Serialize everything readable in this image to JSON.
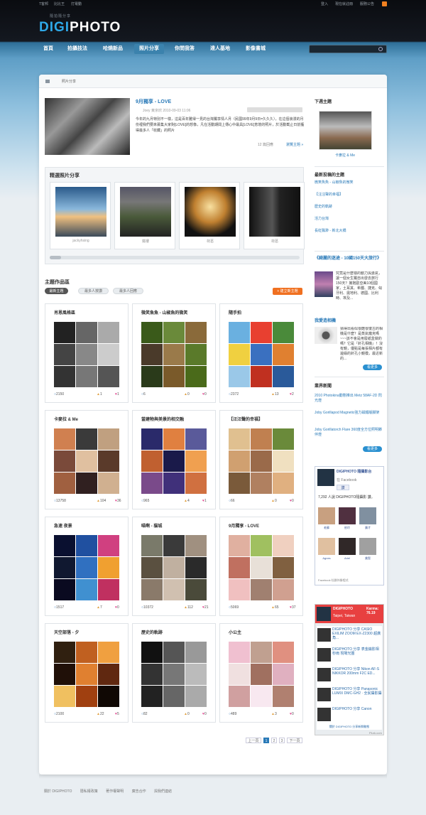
{
  "topbar": {
    "left": [
      "T客邦",
      "比比王",
      "打電動"
    ],
    "right": [
      "登入",
      "現在就註冊",
      "服務公告"
    ]
  },
  "logo": {
    "main": "DIGI",
    "main2": "PHOTO",
    "tagline": "隨拍隨分享"
  },
  "nav": {
    "items": [
      "首頁",
      "拍攝技法",
      "哈燒新品",
      "照片分享",
      "你問我答",
      "達人基地",
      "影像書城"
    ],
    "active": 3
  },
  "search": {
    "placeholder": ""
  },
  "breadcrumb": {
    "label": "照片分享"
  },
  "featured": {
    "title": "9月獨享 - LOVE",
    "meta": "Joey 東京欣 2010-09-03 11:06",
    "text": "今年的九月特別不一樣，這是百年難得一見的台灣獨享情人月（民國99年9月9日=久久久），在這個浪漫的月份裡我們要來募集大家對[LOVE]的想像，凡在活動期間上傳心中最具[LOVE]意境的照片，於活動截止日前獲得最多人「收藏」的照片",
    "comments": "12 篇回應",
    "more": "瀏覽主題 »"
  },
  "picks": {
    "title": "精選照片分享",
    "items": [
      {
        "name": "jackyhsing"
      },
      {
        "name": "鐵樓"
      },
      {
        "name": "荷葛"
      },
      {
        "name": "荷葛"
      }
    ]
  },
  "topics": {
    "title": "主題作品區",
    "tabs": [
      "最新主題",
      "最多人按讚",
      "最多人回應"
    ],
    "new_button": "+ 建立新主題",
    "cards": [
      {
        "title": "肖恩風格區",
        "views": "2150",
        "likes": "1",
        "hearts": "1"
      },
      {
        "title": "微笑魚魚 - 山椒魚的微笑",
        "views": "6",
        "likes": "0",
        "hearts": "0"
      },
      {
        "title": "隨手拍",
        "views": "2372",
        "likes": "13",
        "hearts": "2"
      },
      {
        "title": "卡麥拉 & Me",
        "views": "13758",
        "likes": "104",
        "hearts": "36"
      },
      {
        "title": "當建物與美景的相交融",
        "views": "965",
        "likes": "4",
        "hearts": "1"
      },
      {
        "title": "【汪汪聲的幸福】",
        "views": "66",
        "likes": "0",
        "hearts": "0"
      },
      {
        "title": "急速 夜景",
        "views": "1517",
        "likes": "7",
        "hearts": "0"
      },
      {
        "title": "喵啊 - 貓城",
        "views": "10372",
        "likes": "112",
        "hearts": "21"
      },
      {
        "title": "9月獨享 - LOVE",
        "views": "5069",
        "likes": "65",
        "hearts": "37"
      },
      {
        "title": "天空部落 - 夕",
        "views": "2100",
        "likes": "22",
        "hearts": "5"
      },
      {
        "title": "歷史的軌跡",
        "views": "82",
        "likes": "0",
        "hearts": "0"
      },
      {
        "title": "小公主",
        "views": "489",
        "likes": "3",
        "hearts": "0"
      }
    ]
  },
  "pagination": {
    "prev": "上一頁",
    "pages": [
      "1",
      "2",
      "3"
    ],
    "next": "下一頁",
    "current": "1"
  },
  "sidebar": {
    "next_title": "下週主題",
    "next_caption": "卡麥拉 & Me",
    "recent_title": "最新投稿的主題",
    "recent": [
      "微笑魚魚 - 山椒魚的微笑",
      "【汪汪聲的幸福】",
      "歷史的軌跡",
      "活力台灣",
      "長虹飄渺 - 新北大橋"
    ],
    "book_title": "《綺麗的迷途 - 10國150天大旅行》",
    "book_text": "究竟是什麼樣的動力與勇氣，讓一個女生獨自出發去旅行150天？擁抱歐亞美10個國家，土耳其、希臘、捷克、匈牙利、奧地利、德國、比利時、埃及...",
    "camera_title": "我愛造相機",
    "camera_text": "猜得出看似很酷很復古的相機是什麼？是蒸氣龐克嗎~~~該不會是用廢紙盒做的嗎？它是『針孔相機』！沒有鏡，優點是每張相片都有邊緣的針孔小鏡模，最近新的...",
    "more": "看更多",
    "news_title": "業界新聞",
    "news": [
      "2010 Photokina動態推出 Metz 58AF-2D 閃光燈",
      "Joby Gorillapod Magnetic強力磁鐵版腳架",
      "Joby Gorillatorch Flare 360度全方位照明夥伴燈"
    ],
    "fb_name": "DIGIPHOTO 隨攝影台",
    "fb_sub": "在 Facebook",
    "fb_like": "讚",
    "fb_count": "7,292 人說 DIGIPHOTO隨攝影 讚。",
    "fb_people": [
      "老蘇",
      "依玲",
      "廣才",
      "Agnes",
      "Ariel",
      "美智"
    ],
    "fb_footer": "Facebook 社群外掛程式",
    "plurk_name": "DIGIPHOTO",
    "plurk_karma": "Karma: 76.19",
    "plurk_loc": "Taipei, Taiwan",
    "plurk_items": [
      "DIGIPHOTO 分享 CASIO EXILIM ZOOM EX-Z2300 超廣角...",
      "DIGIPHOTO 分享 表金鑰影相秒雨 現場光圈",
      "DIGIPHOTO 分享 Nikon AF-S NIKKOR 200mm F2C ED...",
      "DIGIPHOTO 分享 Panasonic LUMIX DMC-GH2 · 全民攝影攝",
      "DIGIPHOTO 分享 Canon"
    ],
    "plurk_footer": "關於 DIGIPHOTO 分享新鮮動態",
    "plurk_brand": "Plurk.com"
  },
  "footer": {
    "links": [
      "關於 DIGIPHOTO",
      "隱私權政策",
      "著作權聲明",
      "廣告合作",
      "與我們連結"
    ]
  },
  "colors": {
    "accent": "#2a7ab8",
    "brand": "#2ea8e8",
    "orange": "#f07020"
  }
}
